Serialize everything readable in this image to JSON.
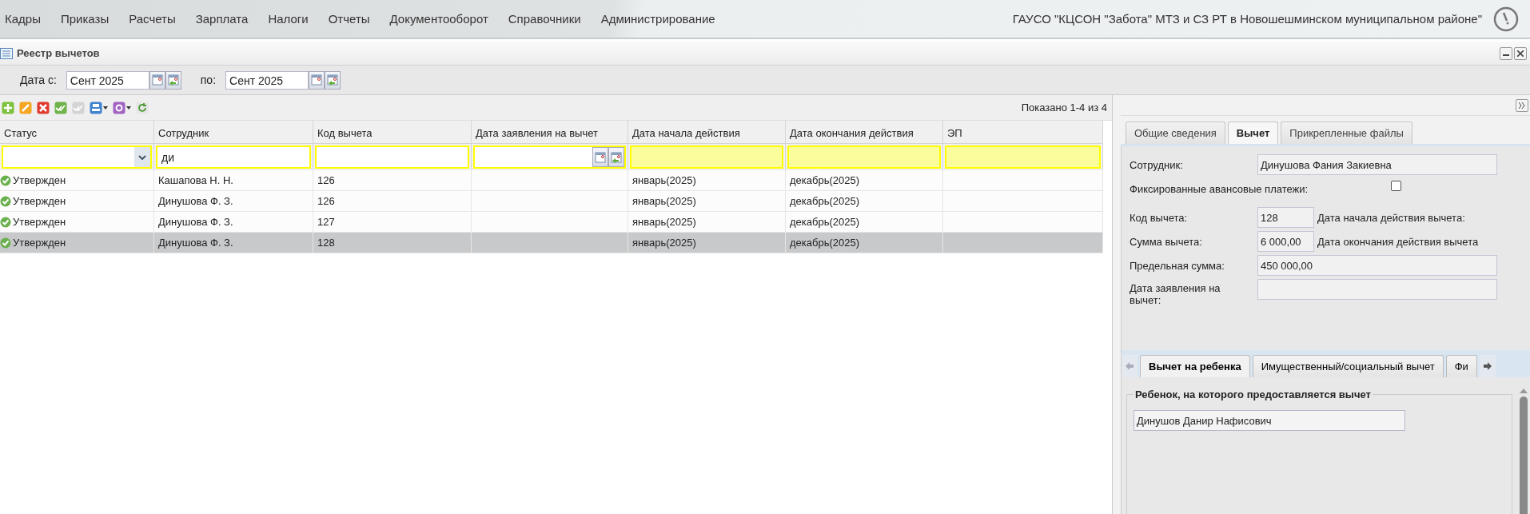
{
  "menu": [
    {
      "label": "Кадры"
    },
    {
      "label": "Приказы"
    },
    {
      "label": "Расчеты"
    },
    {
      "label": "Зарплата"
    },
    {
      "label": "Налоги"
    },
    {
      "label": "Отчеты"
    },
    {
      "label": "Документооборот"
    },
    {
      "label": "Справочники"
    },
    {
      "label": "Администрирование"
    }
  ],
  "organization": "ГАУСО \"КЦСОН \"Забота\" МТЗ и СЗ РТ в Новошешминском муниципальном районе\"",
  "window": {
    "title": "Реестр вычетов"
  },
  "period": {
    "from_label": "Дата с:",
    "from": "Сент 2025",
    "to_label": "по:",
    "to": "Сент 2025"
  },
  "pager": "Показано 1-4 из 4",
  "table": {
    "columns": [
      {
        "title": "Статус",
        "kind": "select"
      },
      {
        "title": "Сотрудник",
        "kind": "text",
        "filter": "ди"
      },
      {
        "title": "Код вычета",
        "kind": "text"
      },
      {
        "title": "Дата заявления на вычет",
        "kind": "date"
      },
      {
        "title": "Дата начала действия",
        "kind": "plain"
      },
      {
        "title": "Дата окончания действия",
        "kind": "plain"
      },
      {
        "title": "ЭП",
        "kind": "plain"
      }
    ],
    "rows": [
      {
        "selected": false,
        "status": "Утвержден",
        "employee": "Кашапова Н. Н.",
        "code": "126",
        "start": "январь(2025)",
        "end": "декабрь(2025)"
      },
      {
        "selected": false,
        "status": "Утвержден",
        "employee": "Динушова Ф. З.",
        "code": "126",
        "start": "январь(2025)",
        "end": "декабрь(2025)"
      },
      {
        "selected": false,
        "status": "Утвержден",
        "employee": "Динушова Ф. З.",
        "code": "127",
        "start": "январь(2025)",
        "end": "декабрь(2025)"
      },
      {
        "selected": true,
        "status": "Утвержден",
        "employee": "Динушова Ф. З.",
        "code": "128",
        "start": "январь(2025)",
        "end": "декабрь(2025)"
      }
    ]
  },
  "detail": {
    "tabs": [
      {
        "label": "Общие сведения",
        "selected": false
      },
      {
        "label": "Вычет",
        "selected": true
      },
      {
        "label": "Прикрепленные файлы",
        "selected": false
      }
    ],
    "employee": {
      "label": "Сотрудник:",
      "value": "Динушова Фания Закиевна"
    },
    "fixed_payments": {
      "label": "Фиксированные авансовые платежи:",
      "checked": false
    },
    "code": {
      "label": "Код вычета:",
      "value": "128",
      "side_label": "Дата начала действия вычета:"
    },
    "sum": {
      "label": "Сумма вычета:",
      "value": "6 000,00",
      "side_label": "Дата окончания действия вычета"
    },
    "limit": {
      "label": "Предельная сумма:",
      "value": "450 000,00"
    },
    "application_date": {
      "label": "Дата заявления на вычет:"
    },
    "subtabs": [
      {
        "label": "Вычет на ребенка",
        "selected": true
      },
      {
        "label": "Имущественный/социальный вычет",
        "selected": false
      },
      {
        "label": "Фи",
        "selected": false
      }
    ],
    "child": {
      "legend": "Ребенок, на которого предоставляется вычет",
      "value": "Динушов Данир Нафисович"
    }
  }
}
